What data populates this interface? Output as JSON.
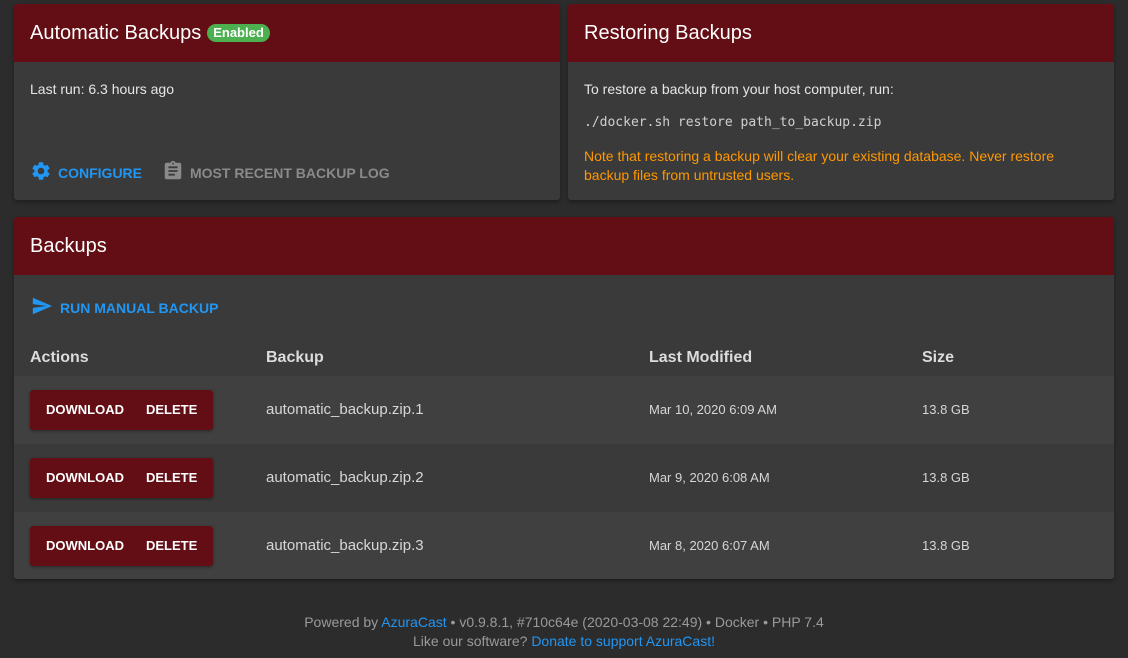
{
  "auto_backups": {
    "title": "Automatic Backups",
    "badge": "Enabled",
    "last_run": "Last run: 6.3 hours ago",
    "configure_label": "Configure",
    "log_label": "Most Recent Backup Log"
  },
  "restore": {
    "title": "Restoring Backups",
    "instruction": "To restore a backup from your host computer, run:",
    "command": "./docker.sh restore path_to_backup.zip",
    "warning": "Note that restoring a backup will clear your existing database. Never restore backup files from untrusted users."
  },
  "backups": {
    "title": "Backups",
    "run_manual_label": "Run Manual Backup",
    "columns": {
      "actions": "Actions",
      "backup": "Backup",
      "modified": "Last Modified",
      "size": "Size"
    },
    "download_label": "Download",
    "delete_label": "Delete",
    "rows": [
      {
        "name": "automatic_backup.zip.1",
        "modified": "Mar 10, 2020 6:09 AM",
        "size": "13.8 GB"
      },
      {
        "name": "automatic_backup.zip.2",
        "modified": "Mar 9, 2020 6:08 AM",
        "size": "13.8 GB"
      },
      {
        "name": "automatic_backup.zip.3",
        "modified": "Mar 8, 2020 6:07 AM",
        "size": "13.8 GB"
      }
    ]
  },
  "footer": {
    "powered_prefix": "Powered by",
    "powered_link": "AzuraCast",
    "version_info": "• v0.9.8.1, #710c64e (2020-03-08 22:49) • Docker • PHP 7.4",
    "like_prefix": "Like our software?",
    "donate_link": "Donate to support AzuraCast!"
  },
  "colors": {
    "header": "#630d14",
    "panel": "#3a3a3a",
    "background": "#2c2c2c",
    "accent": "#2196f3",
    "warning": "#ff9800",
    "success": "#4caf50"
  }
}
